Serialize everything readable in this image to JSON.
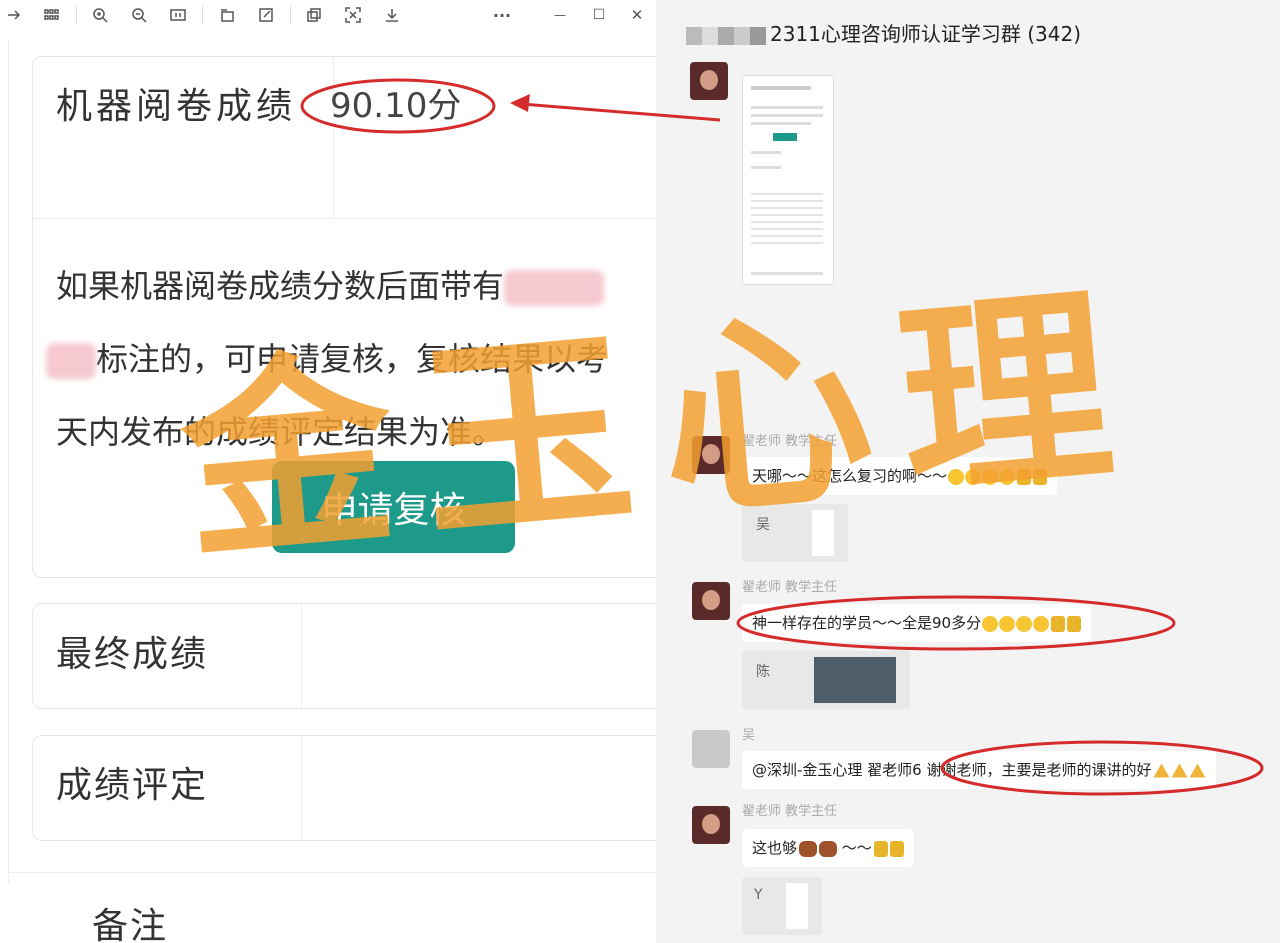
{
  "viewer": {
    "toolbar_icons": [
      "arrow-right-icon",
      "grid-icon",
      "zoom-in-icon",
      "zoom-out-icon",
      "fit-icon",
      "rotate-icon",
      "edit-icon",
      "copy-icon",
      "crop-icon",
      "download-icon",
      "more-icon",
      "minimize-icon",
      "maximize-icon",
      "close-icon"
    ],
    "more_label": "···",
    "minimize_label": "—",
    "maximize_label": "☐",
    "close_label": "✕"
  },
  "result": {
    "machine_score_label": "机器阅卷成绩",
    "machine_score_value": "90.10分",
    "note_text_1": "如果机器阅卷成绩分数后面带有",
    "note_text_2": "标注的，可申请复核，复核结果以考",
    "note_text_3": "天内发布的成绩评定结果为准。",
    "apply_button": "申请复核",
    "final_score_label": "最终成绩",
    "rating_label": "成绩评定",
    "remark_label": "备注"
  },
  "chat": {
    "group_title": "2311心理咨询师认证学习群 (342)",
    "messages": [
      {
        "sender": "翟老师 教学主任",
        "text": "天哪～～这怎么复习的啊～～"
      },
      {
        "sender": "翟老师 教学主任",
        "text": "神一样存在的学员～～全是90多分"
      },
      {
        "sender": "吴",
        "text": "@深圳-金玉心理 翟老师6 谢谢老师，主要是老师的课讲的好"
      },
      {
        "sender": "翟老师 教学主任",
        "text": "这也够"
      }
    ],
    "image_captions": [
      "吴",
      "陈",
      "Y"
    ]
  },
  "watermark": "金玉心理",
  "colors": {
    "accent": "#1e9a8a",
    "annotation": "#d62b2b",
    "watermark": "#f3a030"
  }
}
